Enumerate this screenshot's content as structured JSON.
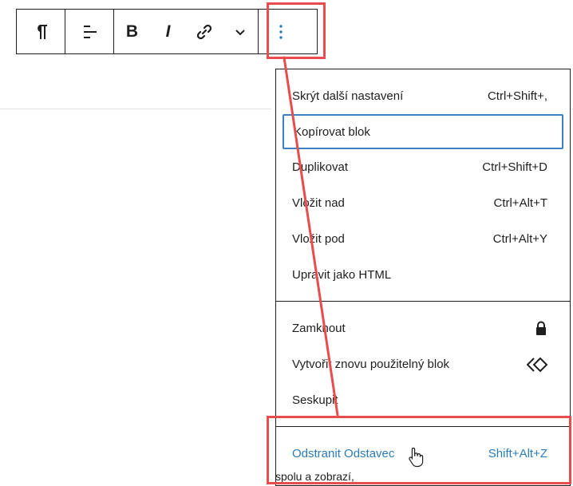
{
  "toolbar": {
    "paragraph_icon": "pilcrow-icon",
    "align_icon": "align-left-icon",
    "bold_label": "B",
    "italic_label": "I",
    "link_icon": "link-icon",
    "more_icon": "chevron-down-icon",
    "options_icon": "more-vertical-icon"
  },
  "menu": {
    "section1": [
      {
        "label": "Skrýt další nastavení",
        "shortcut": "Ctrl+Shift+,"
      },
      {
        "label": "Kopírovat blok",
        "shortcut": ""
      },
      {
        "label": "Duplikovat",
        "shortcut": "Ctrl+Shift+D"
      },
      {
        "label": "Vložit nad",
        "shortcut": "Ctrl+Alt+T"
      },
      {
        "label": "Vložit pod",
        "shortcut": "Ctrl+Alt+Y"
      },
      {
        "label": "Upravit jako HTML",
        "shortcut": ""
      }
    ],
    "section2": [
      {
        "label": "Zamknout",
        "icon": "lock-icon"
      },
      {
        "label": "Vytvořit znovu použitelný blok",
        "icon": "reusable-block-icon"
      },
      {
        "label": "Seskupit",
        "icon": ""
      }
    ],
    "section3": [
      {
        "label": "Odstranit Odstavec",
        "shortcut": "Shift+Alt+Z"
      }
    ]
  },
  "background_text": {
    "line_fragment": "spolu a zobrazí,"
  },
  "colors": {
    "annotation": "#e84c4c",
    "accent": "#2b7bb9",
    "focus_border": "#3b82c4"
  }
}
